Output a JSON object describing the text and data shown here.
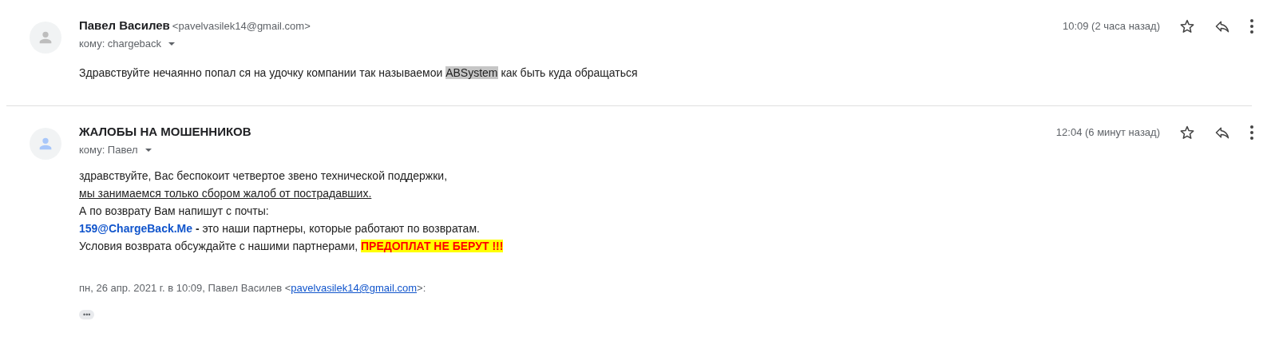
{
  "messages": [
    {
      "sender": "Павел Василев",
      "email": "<pavelvasilek14@gmail.com>",
      "to": "кому: chargeback",
      "time": "10:09 (2 часа назад)",
      "color": "#bdbdbd",
      "starred": false,
      "body": [
        [
          {
            "kind": "plain",
            "text": "Здравствуйте нечаянно попал ся на удочку компании так называемои "
          },
          {
            "kind": "highlight-grey",
            "text": "ABSystem"
          },
          {
            "kind": "plain",
            "text": " как быть куда обращаться"
          }
        ]
      ]
    },
    {
      "sender": "ЖАЛОБЫ НА МОШЕННИКОВ",
      "to": "кому: Павел",
      "time": "12:04 (6 минут назад)",
      "color": "#a8c7fa",
      "starred": false,
      "body": [
        [
          {
            "kind": "plain",
            "text": "здравствуйте, Вас беспокоит четвертое звено технической поддержки,"
          }
        ],
        [
          {
            "kind": "underline",
            "text": "мы занимаемся только сбором жалоб от пострадавших."
          }
        ],
        [
          {
            "kind": "plain",
            "text": "А по возврату Вам напишут с почты:"
          }
        ],
        [
          {
            "kind": "bold-blue",
            "text": "159@ChargeBack.Me"
          },
          {
            "kind": "bold",
            "text": " -"
          },
          {
            "kind": "plain",
            "text": " это наши партнеры, которые работают по возвратам."
          }
        ],
        [
          {
            "kind": "plain",
            "text": "Условия возврата обсуждайте с нашими партнерами, "
          },
          {
            "kind": "highlight-red",
            "text": "ПРЕДОПЛАТ НЕ БЕРУТ !!!"
          }
        ]
      ],
      "quote": {
        "intro": "пн, 26 апр. 2021 г. в 10:09, Павел Василев <",
        "link": "pavelvasilek14@gmail.com",
        "outro": ">:"
      },
      "expand": "•••"
    }
  ]
}
